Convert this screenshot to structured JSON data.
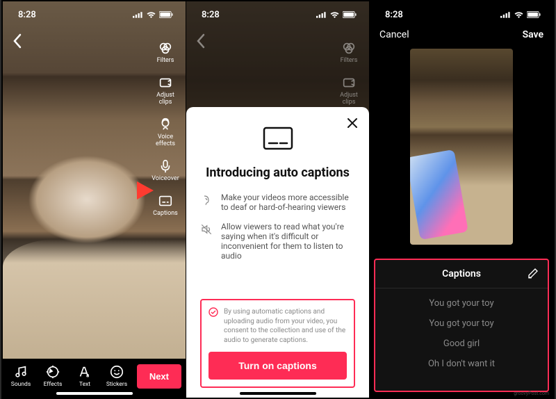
{
  "status": {
    "time": "8:28"
  },
  "screen1": {
    "tools": {
      "filters": "Filters",
      "adjust_clips": "Adjust clips",
      "voice_effects": "Voice effects",
      "voiceover": "Voiceover",
      "captions": "Captions"
    },
    "bottom": {
      "sounds": "Sounds",
      "effects": "Effects",
      "text": "Text",
      "stickers": "Stickers",
      "next": "Next"
    }
  },
  "screen2": {
    "tools_visible": {
      "filters": "Filters",
      "adjust_clips": "Adjust clips"
    },
    "sheet": {
      "title": "Introducing auto captions",
      "bullet1": "Make your videos more accessible to deaf or hard-of-hearing viewers",
      "bullet2": "Allow viewers to read what you're saying when it's difficult or inconvenient for them to listen to audio",
      "consent": "By using automatic captions and uploading audio from your video, you consent to the collection and use of the audio to generate captions.",
      "turn_on": "Turn on captions"
    }
  },
  "screen3": {
    "cancel": "Cancel",
    "save": "Save",
    "captions_title": "Captions",
    "lines": [
      "You got your toy",
      "You got your toy",
      "Good girl",
      "Oh I don't want it"
    ]
  },
  "watermark": "groovyPost.com"
}
